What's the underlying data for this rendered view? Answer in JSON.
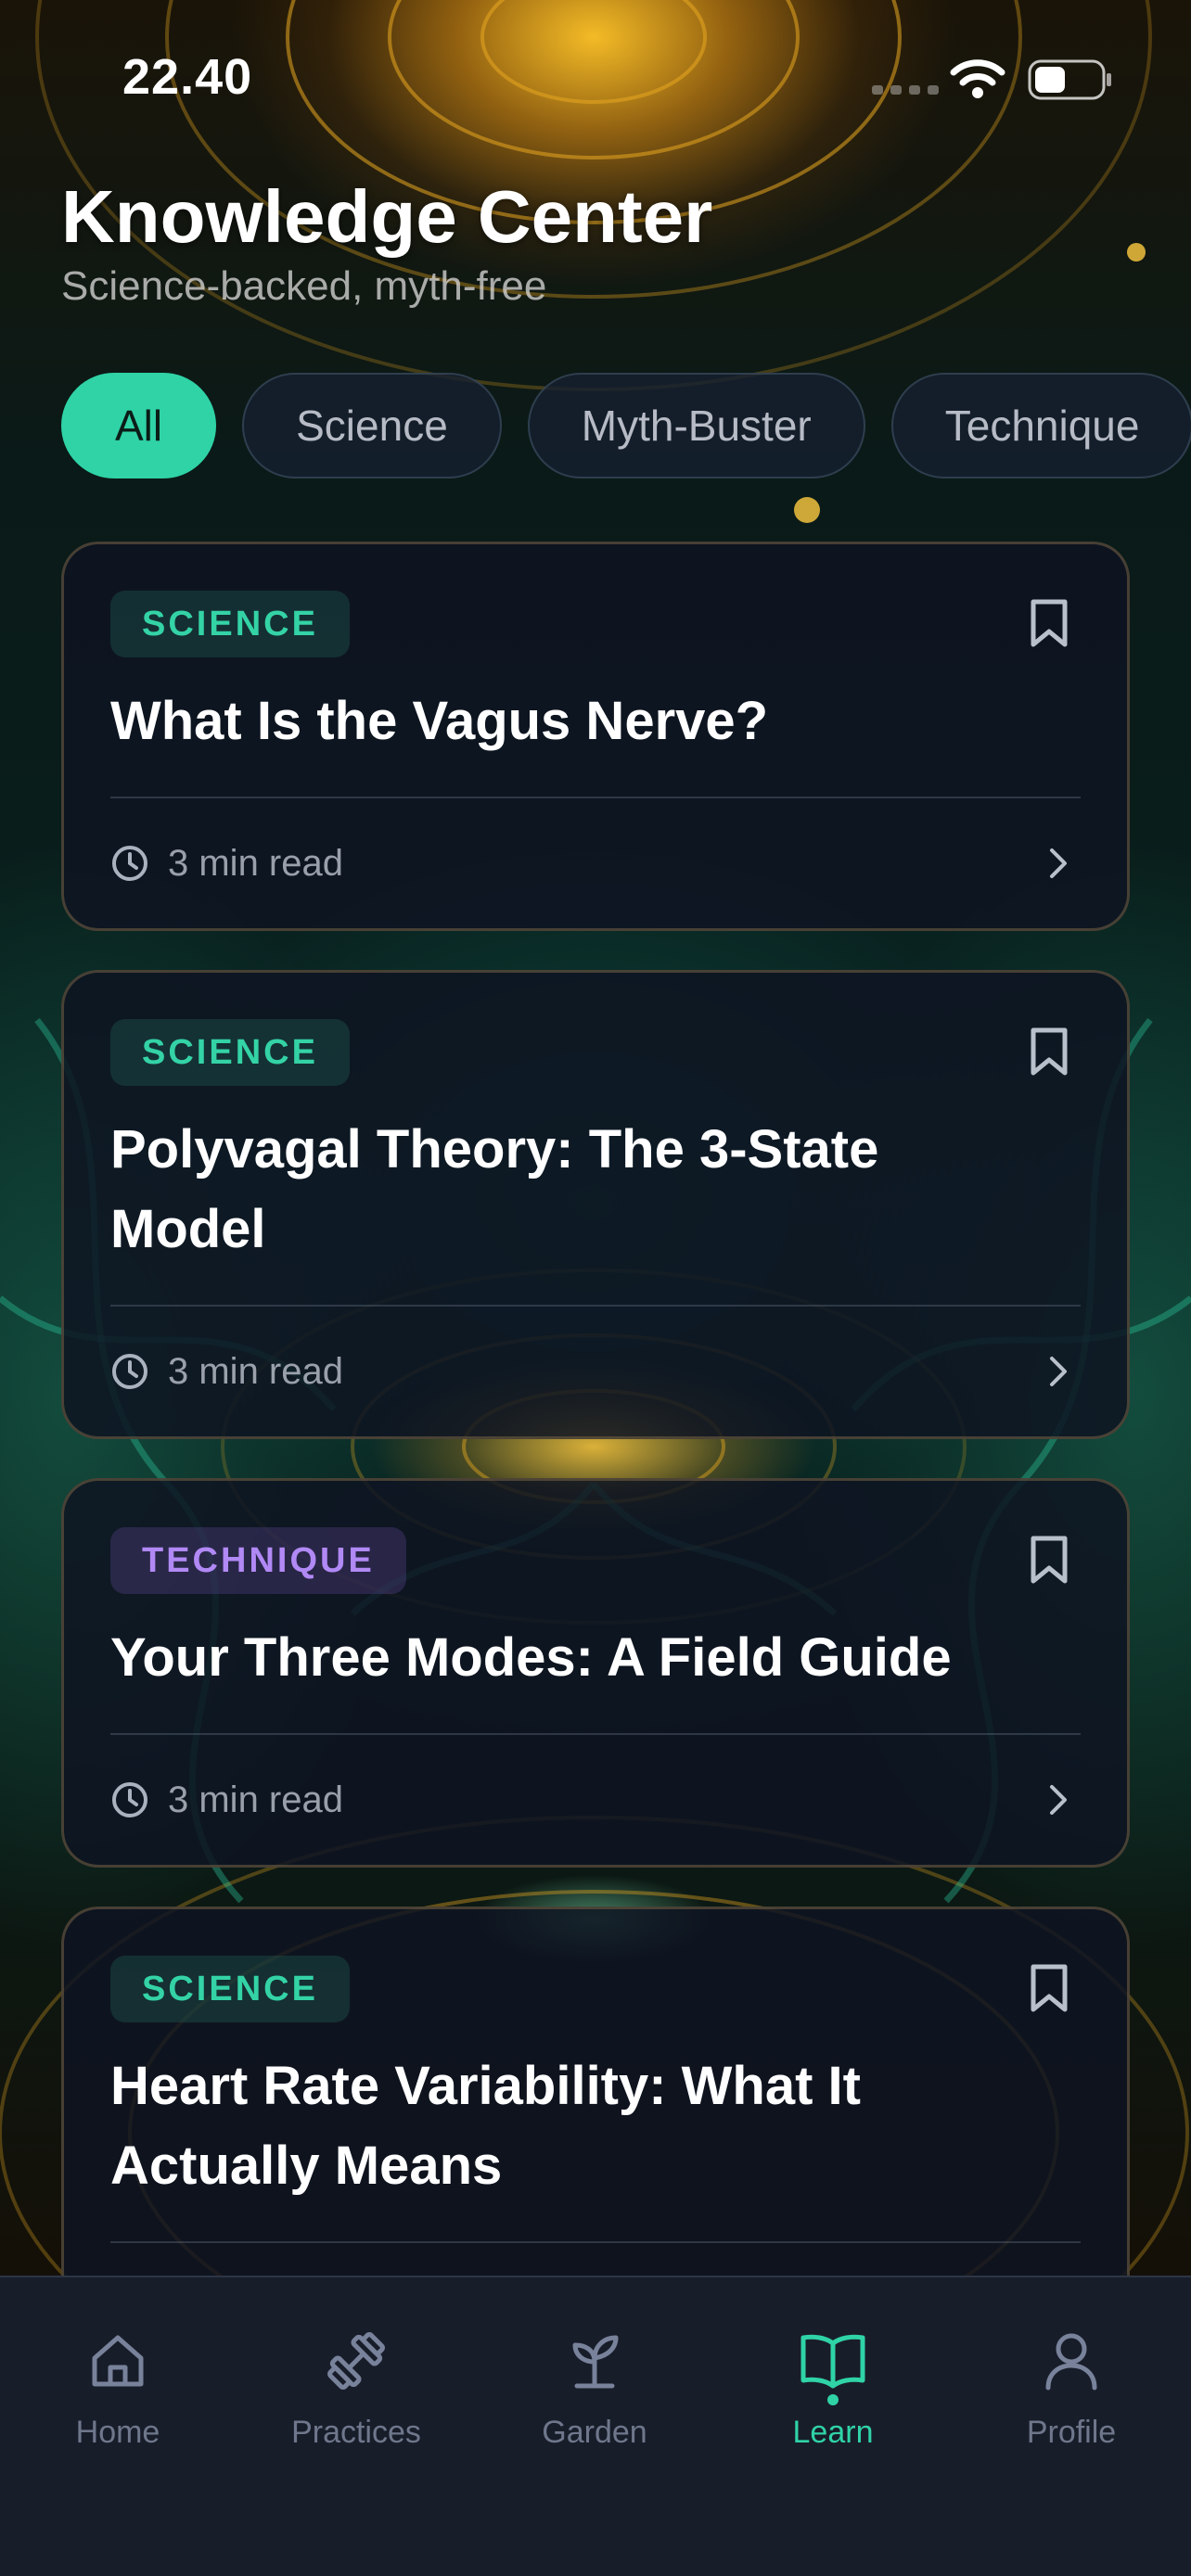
{
  "status_bar": {
    "time": "22.40"
  },
  "header": {
    "title": "Knowledge Center",
    "subtitle": "Science-backed, myth-free"
  },
  "filters": [
    {
      "label": "All",
      "active": true
    },
    {
      "label": "Science",
      "active": false
    },
    {
      "label": "Myth-Buster",
      "active": false
    },
    {
      "label": "Technique",
      "active": false
    }
  ],
  "articles": [
    {
      "tag": "SCIENCE",
      "tag_color": "#34d3a6",
      "title": "What Is the Vagus Nerve?",
      "read_time": "3 min read"
    },
    {
      "tag": "SCIENCE",
      "tag_color": "#34d3a6",
      "title": "Polyvagal Theory: The 3-State Model",
      "read_time": "3 min read"
    },
    {
      "tag": "TECHNIQUE",
      "tag_color": "#b189f5",
      "title": "Your Three Modes: A Field Guide",
      "read_time": "3 min read"
    },
    {
      "tag": "SCIENCE",
      "tag_color": "#34d3a6",
      "title": "Heart Rate Variability: What It Actually Means",
      "read_time": ""
    }
  ],
  "tab_bar": {
    "items": [
      {
        "label": "Home",
        "icon": "home-icon"
      },
      {
        "label": "Practices",
        "icon": "dumbbell-icon"
      },
      {
        "label": "Garden",
        "icon": "sprout-icon"
      },
      {
        "label": "Learn",
        "icon": "book-open-icon",
        "active": true
      },
      {
        "label": "Profile",
        "icon": "user-icon"
      }
    ]
  },
  "colors": {
    "accent": "#2fd3a6",
    "technique": "#b189f5",
    "tab_inactive": "#78829a"
  }
}
